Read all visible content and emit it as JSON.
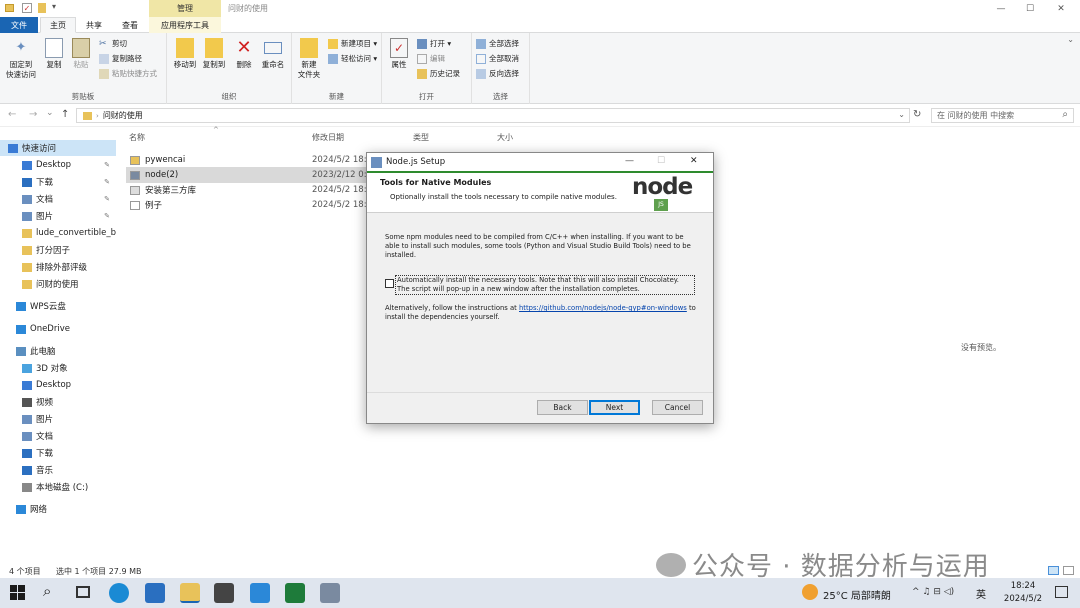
{
  "window": {
    "context_tab": "管理",
    "title": "问财的使用",
    "min": "—",
    "max": "☐",
    "close": "✕"
  },
  "tabs": {
    "file": "文件",
    "home": "主页",
    "share": "共享",
    "view": "查看",
    "app_tools": "应用程序工具"
  },
  "ribbon": {
    "clipboard": {
      "pin": "固定到\n快速访问",
      "copy": "复制",
      "paste": "粘贴",
      "cut": "剪切",
      "copy_path": "复制路径",
      "paste_shortcut": "粘贴快捷方式",
      "label": "剪贴板"
    },
    "organize": {
      "move_to": "移动到",
      "copy_to": "复制到",
      "delete": "删除",
      "rename": "重命名",
      "label": "组织"
    },
    "new": {
      "new_folder": "新建\n文件夹",
      "new_item": "新建项目 ▾",
      "easy_access": "轻松访问 ▾",
      "label": "新建"
    },
    "open": {
      "properties": "属性",
      "open": "打开 ▾",
      "edit": "编辑",
      "history": "历史记录",
      "label": "打开"
    },
    "select": {
      "select_all": "全部选择",
      "select_none": "全部取消",
      "invert": "反向选择",
      "label": "选择"
    }
  },
  "nav": {
    "back": "←",
    "forward": "→",
    "recent": "⌄",
    "up": "↑",
    "path": "问财的使用",
    "dropdown": "⌄",
    "refresh": "↻",
    "search_placeholder": "在 问财的使用 中搜索",
    "search_icon": "⌕"
  },
  "sidebar": {
    "items": [
      {
        "label": "快速访问",
        "pinned": false
      },
      {
        "label": "Desktop",
        "pinned": true
      },
      {
        "label": "下载",
        "pinned": true
      },
      {
        "label": "文档",
        "pinned": true
      },
      {
        "label": "图片",
        "pinned": true
      },
      {
        "label": "lude_convertible_b",
        "pinned": false
      },
      {
        "label": "打分因子",
        "pinned": false
      },
      {
        "label": "排除外部评级",
        "pinned": false
      },
      {
        "label": "问财的使用",
        "pinned": false
      },
      {
        "label": "WPS云盘",
        "pinned": false
      },
      {
        "label": "OneDrive",
        "pinned": false
      },
      {
        "label": "此电脑",
        "pinned": false
      },
      {
        "label": "3D 对象",
        "pinned": false
      },
      {
        "label": "Desktop",
        "pinned": false
      },
      {
        "label": "视频",
        "pinned": false
      },
      {
        "label": "图片",
        "pinned": false
      },
      {
        "label": "文档",
        "pinned": false
      },
      {
        "label": "下载",
        "pinned": false
      },
      {
        "label": "音乐",
        "pinned": false
      },
      {
        "label": "本地磁盘 (C:)",
        "pinned": false
      },
      {
        "label": "网络",
        "pinned": false
      }
    ],
    "pin_glyph": "📌"
  },
  "columns": {
    "name": "名称",
    "modified": "修改日期",
    "type": "类型",
    "size": "大小"
  },
  "files": [
    {
      "name": "pywencai",
      "date": "2024/5/2 18:"
    },
    {
      "name": "node(2)",
      "date": "2023/2/12 0:"
    },
    {
      "name": "安装第三方库",
      "date": "2024/5/2 18:0"
    },
    {
      "name": "例子",
      "date": "2024/5/2 18:1"
    }
  ],
  "preview": {
    "text": "没有预览。"
  },
  "status": {
    "count": "4 个项目",
    "selected": "选中 1 个项目 27.9 MB"
  },
  "dialog": {
    "title": "Node.js Setup",
    "heading": "Tools for Native Modules",
    "subheading": "Optionally install the tools necessary to compile native modules.",
    "logo": "node",
    "logo_js": "JS",
    "body1": "Some npm modules need to be compiled from C/C++ when installing. If you want to be able to install such modules, some tools (Python and Visual Studio Build Tools) need to be installed.",
    "checkbox_label": "Automatically install the necessary tools. Note that this will also install Chocolatey. The script will pop-up in a new window after the installation completes.",
    "alt_prefix": "Alternatively, follow the instructions at ",
    "alt_link": "https://github.com/nodejs/node-gyp#on-windows",
    "alt_suffix": " to install the dependencies yourself.",
    "back": "Back",
    "next": "Next",
    "cancel": "Cancel",
    "min": "—",
    "max": "☐",
    "close": "✕"
  },
  "watermark": "公众号 · 数据分析与运用",
  "taskbar": {
    "weather": "25°C 局部晴朗",
    "lang": "英",
    "time": "18:24",
    "date": "2024/5/2",
    "tray": "^ ♫ ⊟ ◁)"
  },
  "colors": {
    "accent": "#1a65b3",
    "node_green": "#2e8b2e",
    "selection": "#cce4f7"
  }
}
